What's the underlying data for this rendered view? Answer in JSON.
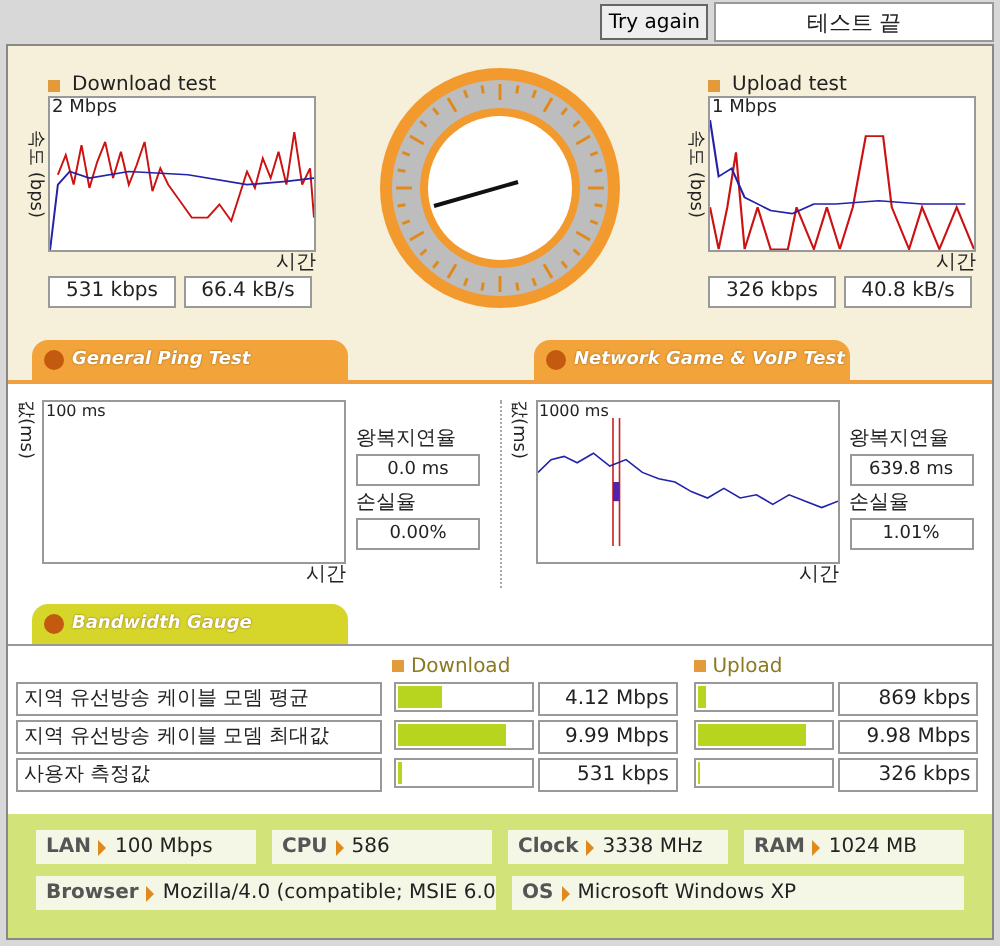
{
  "top_bar": {
    "retry_button": "Try again",
    "status": "테스트 끝"
  },
  "download": {
    "title": "Download test",
    "ylabel": "속도 (bps)",
    "max": "2 Mbps",
    "xlabel": "시간",
    "rate": "531 kbps",
    "bytes": "66.4 kB/s"
  },
  "upload": {
    "title": "Upload test",
    "ylabel": "속도 (bps)",
    "max": "1 Mbps",
    "xlabel": "시간",
    "rate": "326 kbps",
    "bytes": "40.8 kB/s"
  },
  "tabs": [
    "General Ping Test",
    "Network Game & VoIP Test"
  ],
  "ping": [
    {
      "ylabel": "값(ms)",
      "max": "100 ms",
      "xlabel": "시간",
      "latency_label": "왕복지연율",
      "latency": "0.0 ms",
      "loss_label": "손실율",
      "loss": "0.00%",
      "has_data": false
    },
    {
      "ylabel": "값(ms)",
      "max": "1000 ms",
      "xlabel": "시간",
      "latency_label": "왕복지연율",
      "latency": "639.8 ms",
      "loss_label": "손실율",
      "loss": "1.01%",
      "has_data": true
    }
  ],
  "gauge_tab": "Bandwidth Gauge",
  "bandwidth": {
    "download_header": "Download",
    "upload_header": "Upload",
    "rows": [
      {
        "label": "지역 유선방송 케이블 모뎀 평균",
        "download": {
          "level": 0.34,
          "value": "4.12 Mbps"
        },
        "upload": {
          "level": 0.05,
          "value": "869 kbps"
        }
      },
      {
        "label": "지역 유선방송 케이블 모뎀 최대값",
        "download": {
          "level": 0.82,
          "value": "9.99 Mbps"
        },
        "upload": {
          "level": 0.82,
          "value": "9.98 Mbps"
        }
      },
      {
        "label": "사용자 측정값",
        "download": {
          "level": 0.04,
          "value": "531 kbps"
        },
        "upload": {
          "level": 0.01,
          "value": "326 kbps"
        }
      }
    ]
  },
  "system": [
    {
      "label": "LAN",
      "value": "100 Mbps"
    },
    {
      "label": "CPU",
      "value": "586"
    },
    {
      "label": "Clock",
      "value": "3338 MHz"
    },
    {
      "label": "RAM",
      "value": "1024 MB"
    },
    {
      "label": "Browser",
      "value": "Mozilla/4.0 (compatible; MSIE 6.0"
    },
    {
      "label": "OS",
      "value": "Microsoft Windows XP"
    }
  ]
}
